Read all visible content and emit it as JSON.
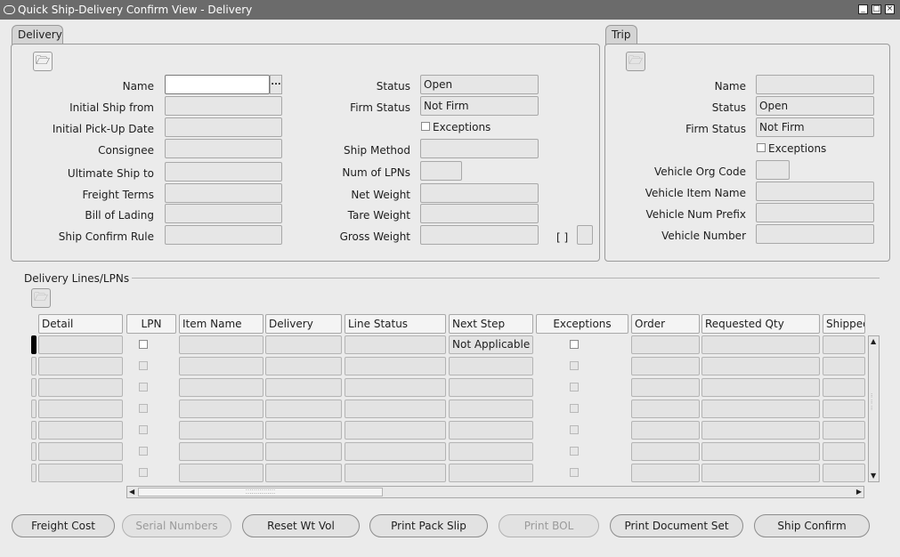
{
  "window": {
    "title": "Quick Ship-Delivery Confirm View - Delivery"
  },
  "delivery": {
    "tab_label": "Delivery",
    "name_label": "Name",
    "initial_ship_from_label": "Initial Ship from",
    "initial_pickup_label": "Initial Pick-Up Date",
    "consignee_label": "Consignee",
    "ultimate_ship_to_label": "Ultimate Ship to",
    "freight_terms_label": "Freight Terms",
    "bill_of_lading_label": "Bill of Lading",
    "ship_confirm_rule_label": "Ship Confirm Rule",
    "status_label": "Status",
    "status_value": "Open",
    "firm_status_label": "Firm Status",
    "firm_status_value": "Not Firm",
    "exceptions_label": "Exceptions",
    "ship_method_label": "Ship Method",
    "num_lpns_label": "Num of LPNs",
    "net_weight_label": "Net Weight",
    "tare_weight_label": "Tare Weight",
    "gross_weight_label": "Gross Weight",
    "bracket_text": "[ ]",
    "lov_text": "..."
  },
  "trip": {
    "tab_label": "Trip",
    "name_label": "Name",
    "status_label": "Status",
    "status_value": "Open",
    "firm_status_label": "Firm Status",
    "firm_status_value": "Not Firm",
    "exceptions_label": "Exceptions",
    "vehicle_org_code_label": "Vehicle Org Code",
    "vehicle_item_name_label": "Vehicle Item Name",
    "vehicle_num_prefix_label": "Vehicle Num Prefix",
    "vehicle_number_label": "Vehicle Number"
  },
  "lines": {
    "section_title": "Delivery Lines/LPNs",
    "columns": {
      "detail": "Detail",
      "lpn": "LPN",
      "item_name": "Item Name",
      "delivery": "Delivery",
      "line_status": "Line Status",
      "next_step": "Next Step",
      "exceptions": "Exceptions",
      "order": "Order",
      "requested_qty": "Requested Qty",
      "shipped": "Shipped"
    },
    "first_row_next_step": "Not Applicable",
    "row_count": 7
  },
  "buttons": {
    "freight_cost": "Freight Cost",
    "serial_numbers": "Serial Numbers",
    "reset_wt_vol": "Reset Wt Vol",
    "print_pack_slip": "Print Pack Slip",
    "print_bol": "Print BOL",
    "print_document_set": "Print Document Set",
    "ship_confirm": "Ship Confirm"
  },
  "icons": {
    "window_minimize": "minimize-icon",
    "window_maximize": "maximize-icon",
    "window_close": "close-icon",
    "folder_open": "open-folder-icon"
  }
}
